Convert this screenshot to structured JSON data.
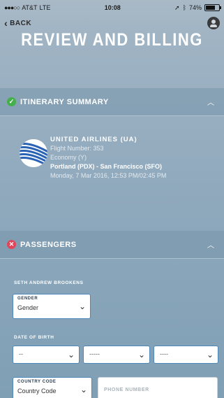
{
  "status": {
    "carrier": "AT&T",
    "network": "LTE",
    "time": "10:08",
    "battery": "74%",
    "battery_level": 0.74
  },
  "nav": {
    "back_label": "BACK"
  },
  "title": "REVIEW AND BILLING",
  "itinerary_section": {
    "label": "ITINERARY SUMMARY",
    "status": "complete"
  },
  "flight": {
    "airline": "UNITED AIRLINES (UA)",
    "flight_number": "Flight Number: 353",
    "cabin": "Economy (Y)",
    "route": "Portland (PDX) - San Francisco (SFO)",
    "datetime": "Monday, 7 Mar 2016, 12:53 PM/02:45 PM"
  },
  "passengers_section": {
    "label": "PASSENGERS",
    "status": "error"
  },
  "passenger": {
    "name": "SETH ANDREW BROOKENS",
    "gender": {
      "label": "GENDER",
      "value": "Gender"
    },
    "dob_label": "DATE OF BIRTH",
    "dob_day": "--",
    "dob_month": "-----",
    "dob_year": "----",
    "country_code": {
      "label": "COUNTRY CODE",
      "value": "Country Code"
    },
    "phone_placeholder": "PHONE NUMBER"
  }
}
